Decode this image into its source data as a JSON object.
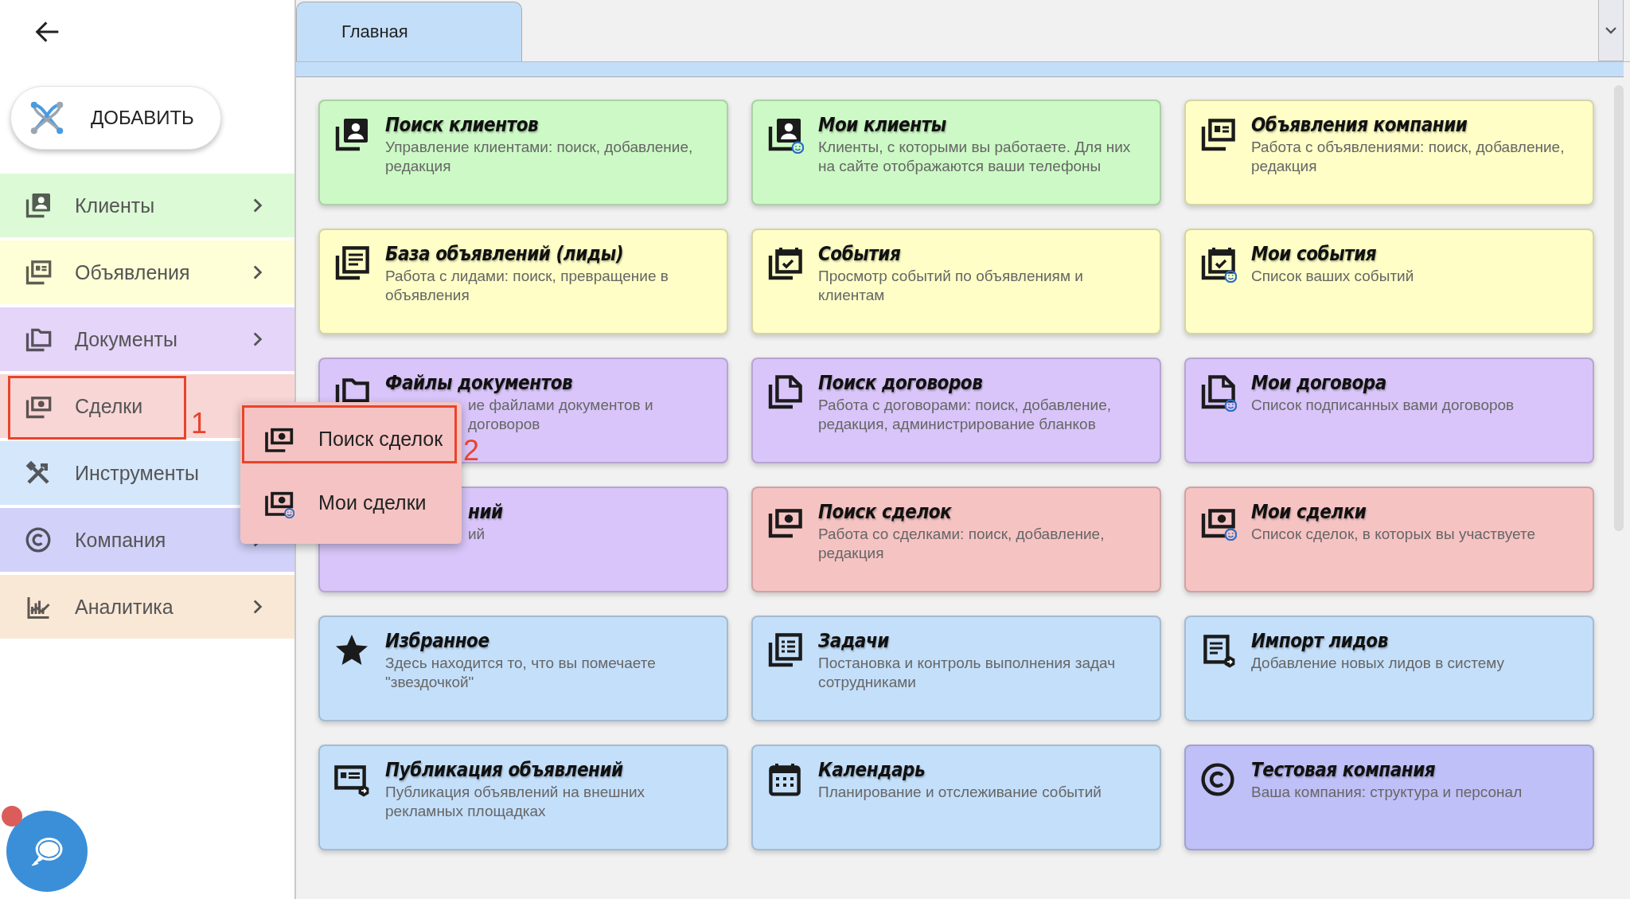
{
  "add_button": {
    "label": "ДОБАВИТЬ"
  },
  "sidebar": {
    "items": [
      {
        "label": "Клиенты",
        "color": "#dbfad5",
        "chevron": true
      },
      {
        "label": "Объявления",
        "color": "#fefed7",
        "chevron": true
      },
      {
        "label": "Документы",
        "color": "#e5d5f9",
        "chevron": true
      },
      {
        "label": "Сделки",
        "color": "#f8d6d6",
        "chevron": false
      },
      {
        "label": "Инструменты",
        "color": "#d5e7fa",
        "chevron": false
      },
      {
        "label": "Компания",
        "color": "#d1d1f9",
        "chevron": true
      },
      {
        "label": "Аналитика",
        "color": "#fae8d7",
        "chevron": true
      }
    ]
  },
  "submenu": {
    "items": [
      {
        "label": "Поиск сделок"
      },
      {
        "label": "Мои сделки"
      }
    ]
  },
  "annotations": [
    {
      "label": "1"
    },
    {
      "label": "2"
    }
  ],
  "tabs": [
    {
      "label": "Главная",
      "selected": true
    }
  ],
  "cards": [
    {
      "title": "Поиск клиентов",
      "description": "Управление клиентами: поиск, добавление, редакция",
      "color": "#ccf9c5",
      "title_covered": false,
      "description_covered": false
    },
    {
      "title": "Мои клиенты",
      "description": "Клиенты, с которыми вы работаете. Для них на сайте отображаются ваши телефоны",
      "color": "#ccf9c5",
      "title_covered": false,
      "description_covered": false
    },
    {
      "title": "Объявления компании",
      "description": "Работа с объявлениями: поиск, добавление, редакция",
      "color": "#fefec6",
      "title_covered": false,
      "description_covered": false
    },
    {
      "title": "База объявлений (лиды)",
      "description": "Работа с лидами: поиск, превращение в объявления",
      "color": "#fefec6",
      "title_covered": false,
      "description_covered": false
    },
    {
      "title": "События",
      "description": "Просмотр событий по объявлениям и клиентам",
      "color": "#fefec6",
      "title_covered": false,
      "description_covered": false
    },
    {
      "title": "Мои события",
      "description": "Список ваших событий",
      "color": "#fefec6",
      "title_covered": false,
      "description_covered": false
    },
    {
      "title": "Файлы документов",
      "description": "ие файлами документов и договоров",
      "color": "#d9c5f9",
      "title_covered": false,
      "description_covered": true
    },
    {
      "title": "Поиск договоров",
      "description": "Работа с договорами: поиск, добавление, редакция, администрирование бланков",
      "color": "#d9c5f9",
      "title_covered": false,
      "description_covered": false
    },
    {
      "title": "Мои договора",
      "description": "Список подписанных вами договоров",
      "color": "#d9c5f9",
      "title_covered": false,
      "description_covered": false
    },
    {
      "title": "ний",
      "description": "ий",
      "color": "#d9c5f9",
      "title_covered": true,
      "description_covered": true
    },
    {
      "title": "Поиск сделок",
      "description": "Работа со сделками: поиск, добавление, редакция",
      "color": "#f6c3c3",
      "title_covered": false,
      "description_covered": false
    },
    {
      "title": "Мои сделки",
      "description": "Список сделок, в которых вы участвуете",
      "color": "#f6c3c3",
      "title_covered": false,
      "description_covered": false
    },
    {
      "title": "Избранное",
      "description": "Здесь находится то, что вы помечаете \"звездочкой\"",
      "color": "#c4dffa",
      "title_covered": false,
      "description_covered": false
    },
    {
      "title": "Задачи",
      "description": "Постановка и контроль выполнения задач сотрудниками",
      "color": "#c4dffa",
      "title_covered": false,
      "description_covered": false
    },
    {
      "title": "Импорт лидов",
      "description": "Добавление новых лидов в систему",
      "color": "#c4dffa",
      "title_covered": false,
      "description_covered": false
    },
    {
      "title": "Публикация объявлений",
      "description": "Публикация объявлений на внешних рекламных площадках",
      "color": "#c4dffa",
      "title_covered": false,
      "description_covered": false
    },
    {
      "title": "Календарь",
      "description": "Планирование и отслеживание событий",
      "color": "#c4dffa",
      "title_covered": false,
      "description_covered": false
    },
    {
      "title": "Тестовая компания",
      "description": "Ваша компания: структура и персонал",
      "color": "#c0c0f8",
      "title_covered": false,
      "description_covered": false
    }
  ]
}
